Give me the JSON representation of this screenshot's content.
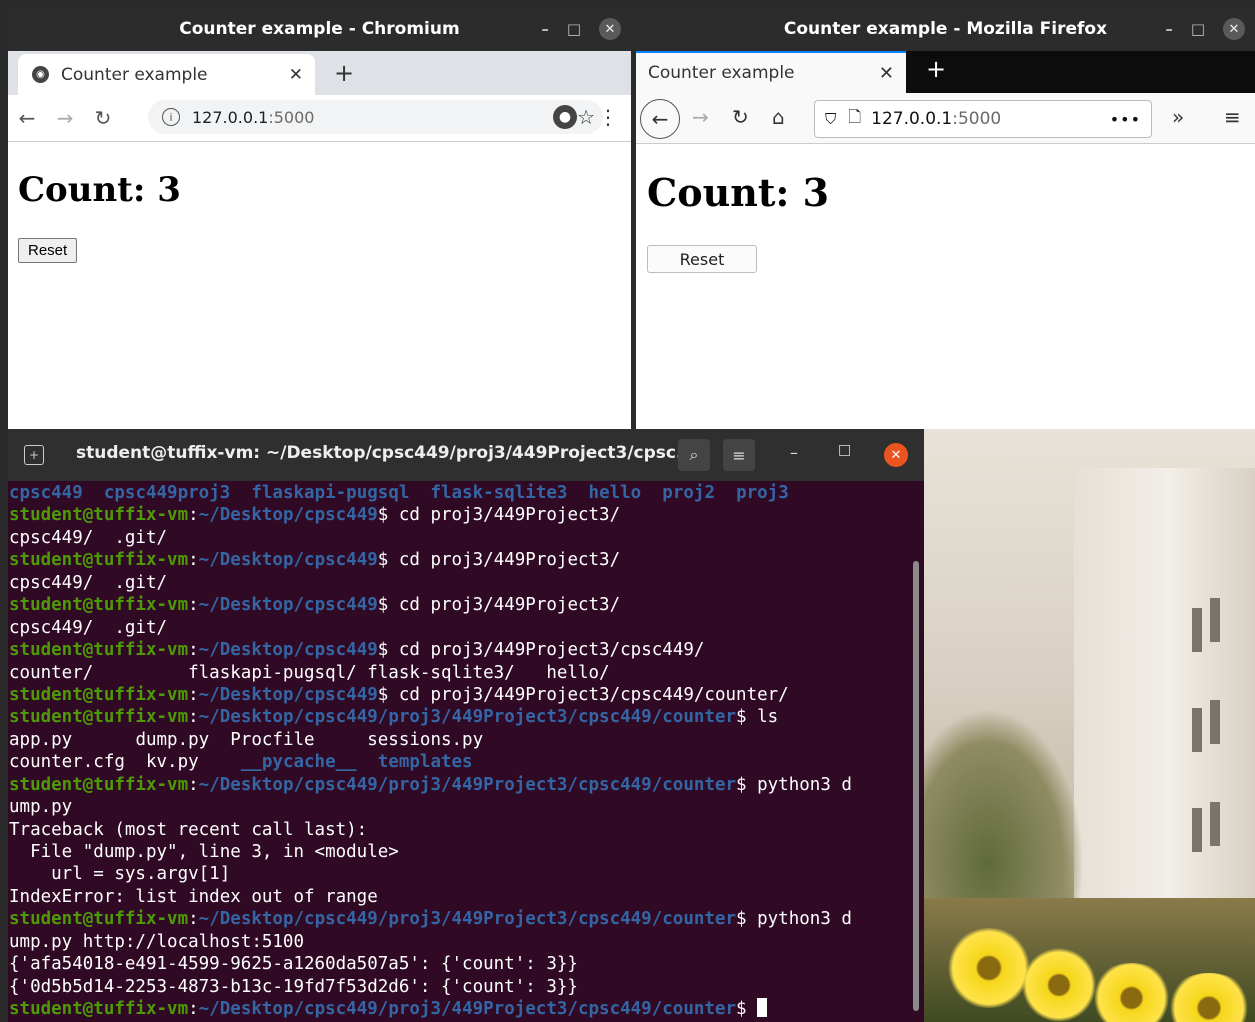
{
  "chromium": {
    "window_title": "Counter example - Chromium",
    "tab_title": "Counter example",
    "url_host": "127.0.0.1",
    "url_port": ":5000",
    "count_text": "Count: 3",
    "reset_label": "Reset"
  },
  "firefox": {
    "window_title": "Counter example - Mozilla Firefox",
    "tab_title": "Counter example",
    "url_host": "127.0.0.1",
    "url_port": ":5000",
    "count_text": "Count: 3",
    "reset_label": "Reset"
  },
  "terminal": {
    "title": "student@tuffix-vm: ~/Desktop/cpsc449/proj3/449Project3/cpsc...",
    "prompt_user": "student@tuffix-vm",
    "lines": [
      {
        "type": "dirs",
        "items": [
          "cpsc449",
          "cpsc449proj3",
          "flaskapi-pugsql",
          "flask-sqlite3",
          "hello",
          "proj2",
          "proj3"
        ]
      },
      {
        "type": "prompt",
        "path": "~/Desktop/cpsc449",
        "cmd": " cd proj3/449Project3/"
      },
      {
        "type": "text",
        "text": "cpsc449/  .git/"
      },
      {
        "type": "prompt",
        "path": "~/Desktop/cpsc449",
        "cmd": " cd proj3/449Project3/"
      },
      {
        "type": "text",
        "text": "cpsc449/  .git/"
      },
      {
        "type": "prompt",
        "path": "~/Desktop/cpsc449",
        "cmd": " cd proj3/449Project3/"
      },
      {
        "type": "text",
        "text": "cpsc449/  .git/"
      },
      {
        "type": "prompt",
        "path": "~/Desktop/cpsc449",
        "cmd": " cd proj3/449Project3/cpsc449/"
      },
      {
        "type": "text",
        "text": "counter/         flaskapi-pugsql/ flask-sqlite3/   hello/"
      },
      {
        "type": "prompt",
        "path": "~/Desktop/cpsc449",
        "cmd": " cd proj3/449Project3/cpsc449/counter/"
      },
      {
        "type": "prompt",
        "path": "~/Desktop/cpsc449/proj3/449Project3/cpsc449/counter",
        "cmd": " ls"
      },
      {
        "type": "ls",
        "items": [
          "app.py      ",
          "dump.py  ",
          "Procfile     ",
          "sessions.py"
        ]
      },
      {
        "type": "ls2",
        "items": [
          "counter.cfg  ",
          "kv.py    ",
          "__pycache__",
          "  templates"
        ]
      },
      {
        "type": "prompt",
        "path": "~/Desktop/cpsc449/proj3/449Project3/cpsc449/counter",
        "cmd": " python3 d"
      },
      {
        "type": "text",
        "text": "ump.py"
      },
      {
        "type": "text",
        "text": "Traceback (most recent call last):"
      },
      {
        "type": "text",
        "text": "  File \"dump.py\", line 3, in <module>"
      },
      {
        "type": "text",
        "text": "    url = sys.argv[1]"
      },
      {
        "type": "text",
        "text": "IndexError: list index out of range"
      },
      {
        "type": "prompt",
        "path": "~/Desktop/cpsc449/proj3/449Project3/cpsc449/counter",
        "cmd": " python3 d"
      },
      {
        "type": "text",
        "text": "ump.py http://localhost:5100"
      },
      {
        "type": "text",
        "text": "{'afa54018-e491-4599-9625-a1260da507a5': {'count': 3}}"
      },
      {
        "type": "text",
        "text": "{'0d5b5d14-2253-4873-b13c-19fd7f53d2d6': {'count': 3}}"
      },
      {
        "type": "prompt_cursor",
        "path": "~/Desktop/cpsc449/proj3/449Project3/cpsc449/counter",
        "cmd": " "
      }
    ]
  },
  "colors": {
    "terminal_bg": "#300a24",
    "prompt_green": "#4e9a06",
    "path_blue": "#3465a4",
    "ubuntu_orange": "#e95420"
  }
}
